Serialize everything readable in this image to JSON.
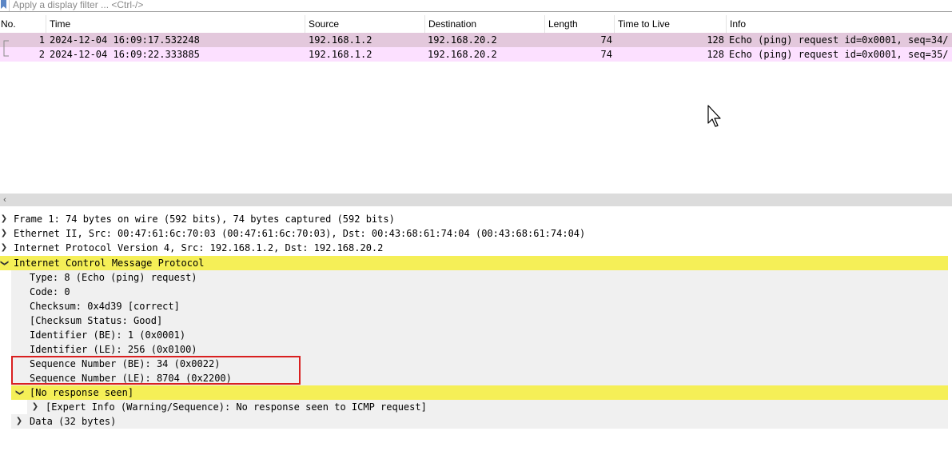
{
  "filter": {
    "placeholder": "Apply a display filter ... <Ctrl-/>"
  },
  "packet_list": {
    "columns": [
      "No.",
      "Time",
      "Source",
      "Destination",
      "Length",
      "Time to Live",
      "Info"
    ],
    "rows": [
      {
        "no": "1",
        "time": "2024-12-04 16:09:17.532248",
        "source": "192.168.1.2",
        "destination": "192.168.20.2",
        "length": "74",
        "ttl": "128",
        "info": "Echo (ping) request  id=0x0001, seq=34/"
      },
      {
        "no": "2",
        "time": "2024-12-04 16:09:22.333885",
        "source": "192.168.1.2",
        "destination": "192.168.20.2",
        "length": "74",
        "ttl": "128",
        "info": "Echo (ping) request  id=0x0001, seq=35/"
      }
    ]
  },
  "details": {
    "frame": "Frame 1: 74 bytes on wire (592 bits), 74 bytes captured (592 bits)",
    "ethernet": "Ethernet II, Src: 00:47:61:6c:70:03 (00:47:61:6c:70:03), Dst: 00:43:68:61:74:04 (00:43:68:61:74:04)",
    "ip": "Internet Protocol Version 4, Src: 192.168.1.2, Dst: 192.168.20.2",
    "icmp": "Internet Control Message Protocol",
    "icmp_fields": [
      "Type: 8 (Echo (ping) request)",
      "Code: 0",
      "Checksum: 0x4d39 [correct]",
      "[Checksum Status: Good]",
      "Identifier (BE): 1 (0x0001)",
      "Identifier (LE): 256 (0x0100)",
      "Sequence Number (BE): 34 (0x0022)",
      "Sequence Number (LE): 8704 (0x2200)"
    ],
    "no_response": "[No response seen]",
    "expert_info": "[Expert Info (Warning/Sequence): No response seen to ICMP request]",
    "data": "Data (32 bytes)"
  },
  "colors": {
    "row_selected": "#e3c8dc",
    "row_normal": "#fce0ff",
    "highlight_yellow": "#f5ef57",
    "annotation_red": "#d92020"
  }
}
